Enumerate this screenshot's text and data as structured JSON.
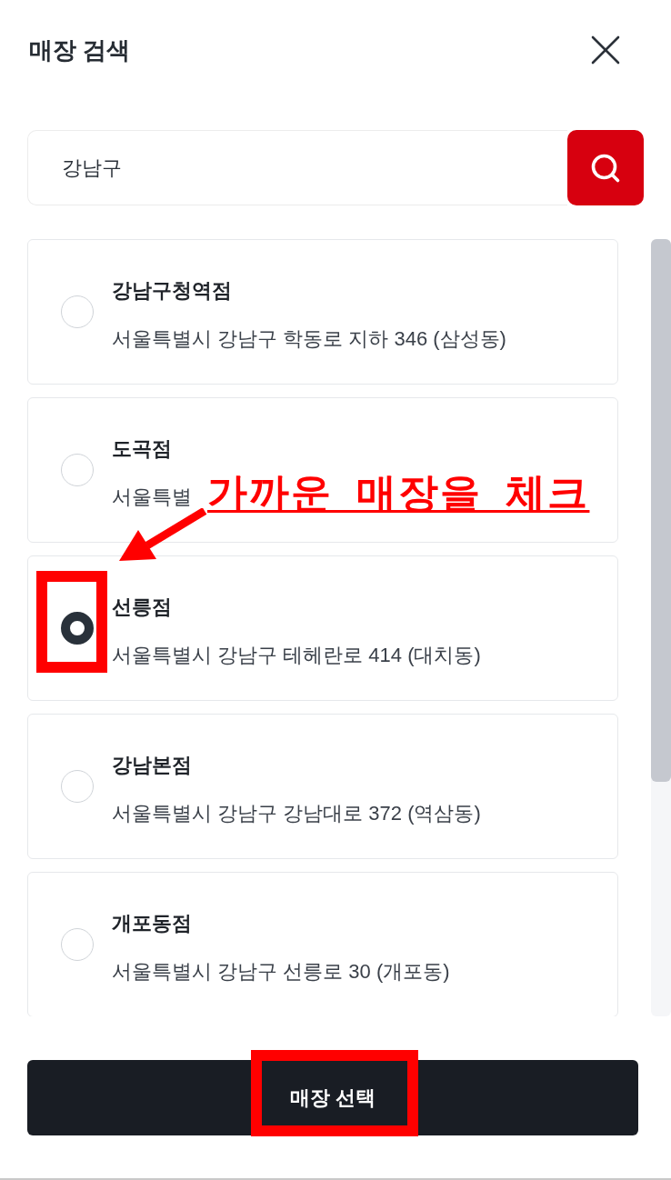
{
  "header": {
    "title": "매장 검색"
  },
  "search": {
    "value": "강남구"
  },
  "stores": [
    {
      "name": "강남구청역점",
      "address": "서울특별시 강남구 학동로 지하 346 (삼성동)",
      "selected": false
    },
    {
      "name": "도곡점",
      "address": "서울특별",
      "selected": false
    },
    {
      "name": "선릉점",
      "address": "서울특별시 강남구 테헤란로 414 (대치동)",
      "selected": true
    },
    {
      "name": "강남본점",
      "address": "서울특별시 강남구 강남대로 372 (역삼동)",
      "selected": false
    },
    {
      "name": "개포동점",
      "address": "서울특별시 강남구 선릉로 30 (개포동)",
      "selected": false
    }
  ],
  "confirm_button": {
    "label": "매장 선택"
  },
  "annotation": {
    "note": "가까운 매장을 체크"
  }
}
